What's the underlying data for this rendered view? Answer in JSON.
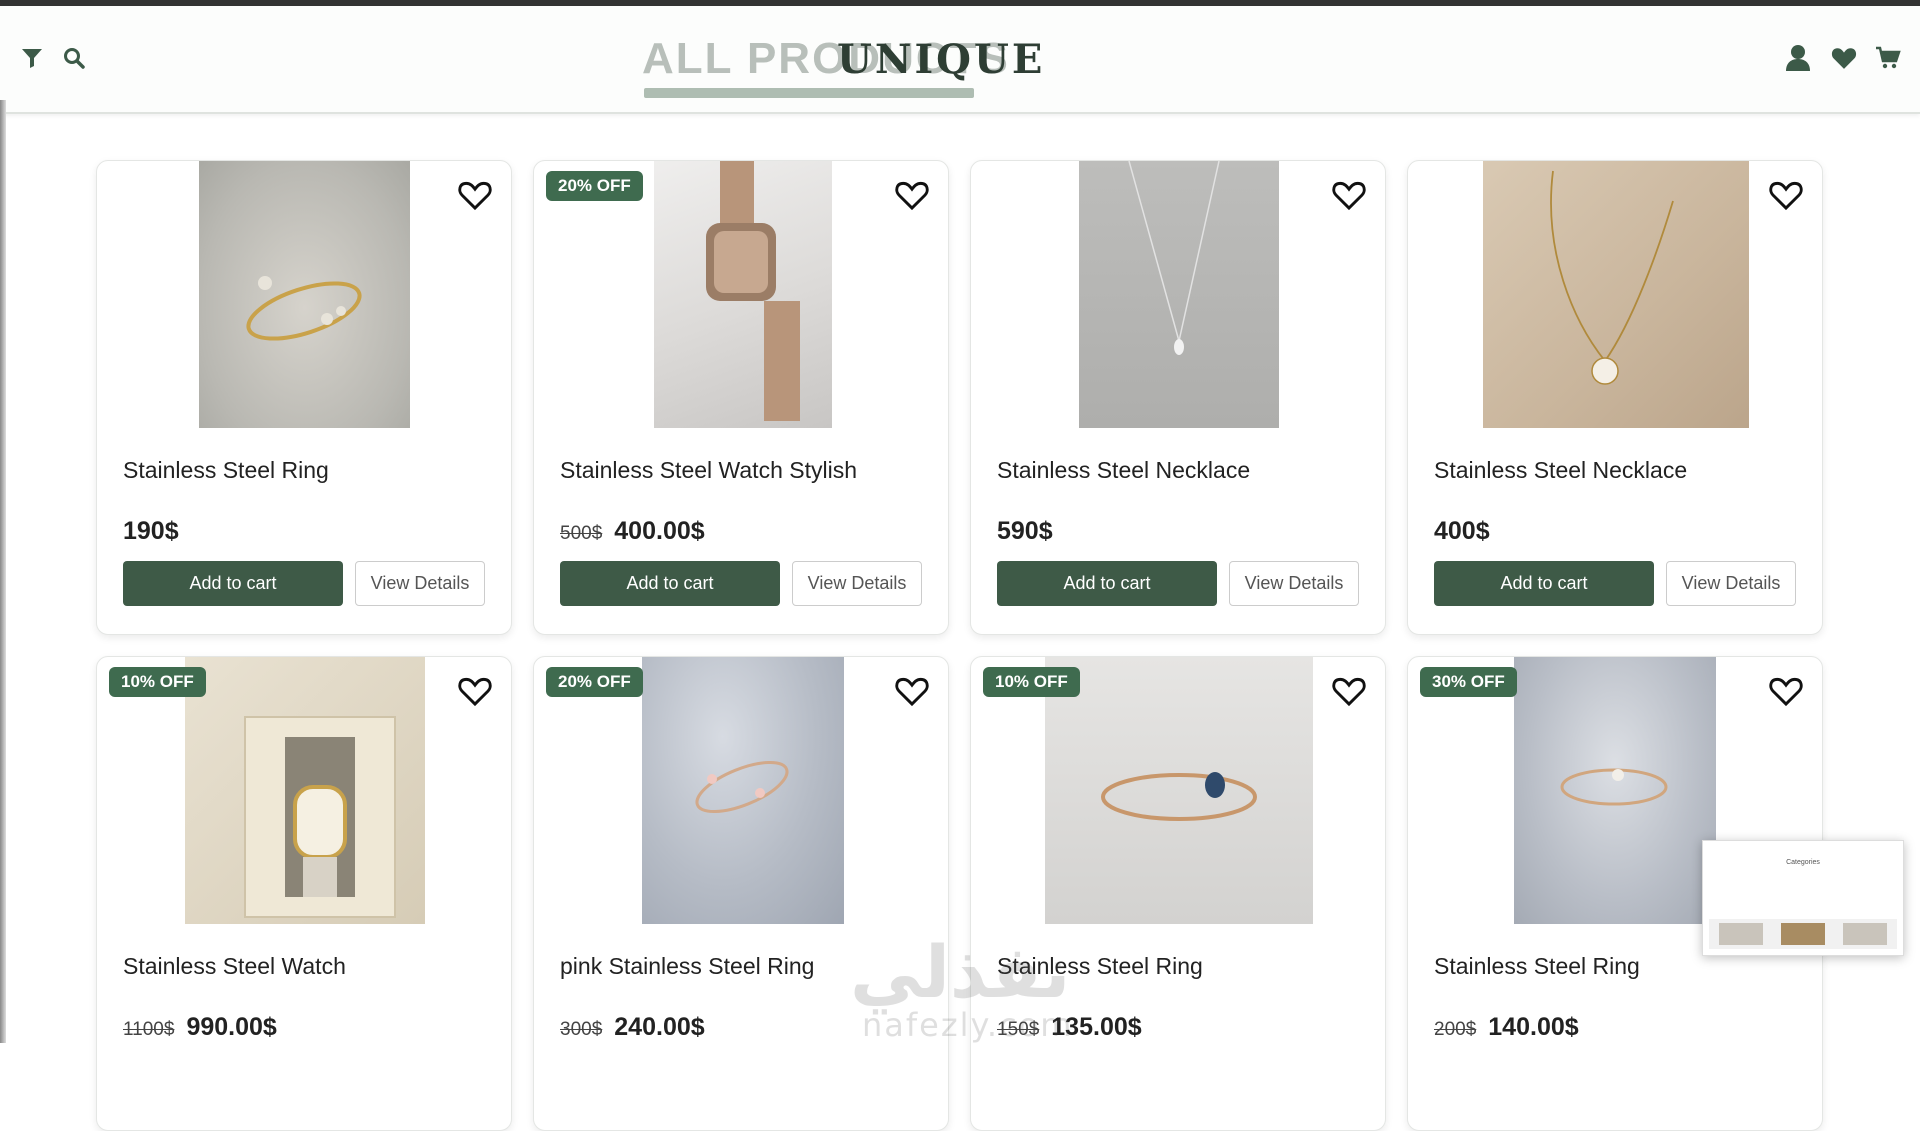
{
  "header": {
    "title_back": "ALL PRODUCTS",
    "brand": "UNIQUE",
    "icons": [
      "filter-icon",
      "search-icon",
      "user-icon",
      "heart-icon",
      "cart-icon"
    ]
  },
  "colors": {
    "primary": "#3e5a47",
    "badge": "#3f6b4f",
    "title_gray": "#b8bfba"
  },
  "products": [
    {
      "name": "Stainless Steel Ring",
      "old_price": "",
      "price": "190$",
      "badge": "",
      "add_label": "Add to cart",
      "view_label": "View Details"
    },
    {
      "name": "Stainless Steel Watch Stylish",
      "old_price": "500$",
      "price": "400.00$",
      "badge": "20% OFF",
      "add_label": "Add to cart",
      "view_label": "View Details"
    },
    {
      "name": "Stainless Steel Necklace",
      "old_price": "",
      "price": "590$",
      "badge": "",
      "add_label": "Add to cart",
      "view_label": "View Details"
    },
    {
      "name": "Stainless Steel Necklace",
      "old_price": "",
      "price": "400$",
      "badge": "",
      "add_label": "Add to cart",
      "view_label": "View Details"
    },
    {
      "name": "Stainless Steel Watch",
      "old_price": "1100$",
      "price": "990.00$",
      "badge": "10% OFF",
      "add_label": "Add to cart",
      "view_label": "View Details"
    },
    {
      "name": "pink Stainless Steel Ring",
      "old_price": "300$",
      "price": "240.00$",
      "badge": "20% OFF",
      "add_label": "Add to cart",
      "view_label": "View Details"
    },
    {
      "name": "Stainless Steel Ring",
      "old_price": "150$",
      "price": "135.00$",
      "badge": "10% OFF",
      "add_label": "Add to cart",
      "view_label": "View Details"
    },
    {
      "name": "Stainless Steel Ring",
      "old_price": "200$",
      "price": "140.00$",
      "badge": "30% OFF",
      "add_label": "Add to cart",
      "view_label": "View Details"
    }
  ],
  "watermark": {
    "arabic": "نفذلي",
    "latin": "nafezly.com"
  },
  "preview_thumbnail": {
    "title": "Categories"
  }
}
